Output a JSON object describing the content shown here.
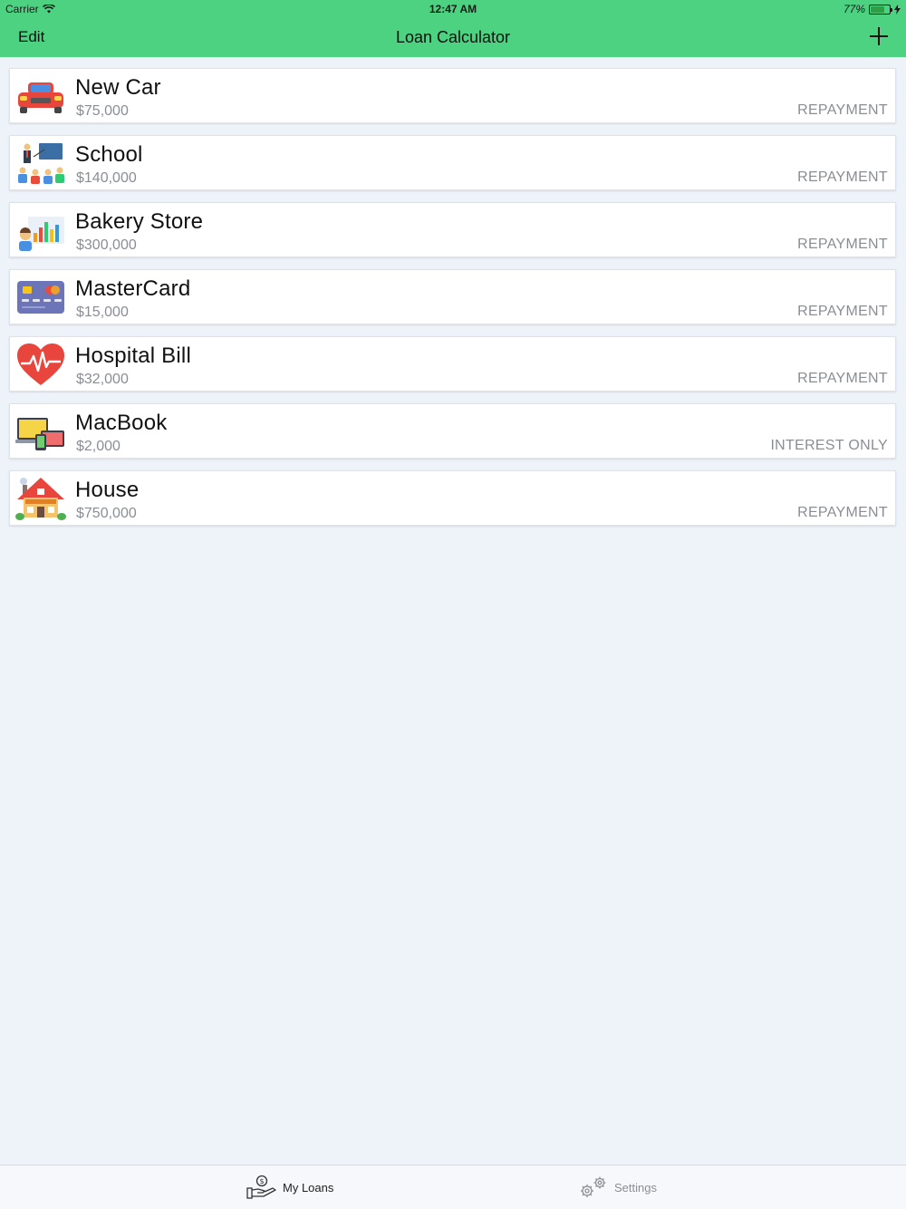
{
  "status_bar": {
    "carrier": "Carrier",
    "time": "12:47 AM",
    "battery": "77%",
    "battery_level": 0.77
  },
  "nav": {
    "edit_label": "Edit",
    "title": "Loan Calculator",
    "add_icon": "plus-icon"
  },
  "loans": [
    {
      "title": "New Car",
      "amount": "$75,000",
      "type": "REPAYMENT",
      "icon": "car-icon"
    },
    {
      "title": "School",
      "amount": "$140,000",
      "type": "REPAYMENT",
      "icon": "school-icon"
    },
    {
      "title": "Bakery Store",
      "amount": "$300,000",
      "type": "REPAYMENT",
      "icon": "bakery-store-icon"
    },
    {
      "title": "MasterCard",
      "amount": "$15,000",
      "type": "REPAYMENT",
      "icon": "credit-card-icon"
    },
    {
      "title": "Hospital Bill",
      "amount": "$32,000",
      "type": "REPAYMENT",
      "icon": "heart-icon"
    },
    {
      "title": "MacBook",
      "amount": "$2,000",
      "type": "INTEREST ONLY",
      "icon": "laptop-icon"
    },
    {
      "title": "House",
      "amount": "$750,000",
      "type": "REPAYMENT",
      "icon": "house-icon"
    }
  ],
  "tabs": [
    {
      "label": "My Loans",
      "icon": "loans-hand-icon",
      "active": true
    },
    {
      "label": "Settings",
      "icon": "gear-icon",
      "active": false
    }
  ],
  "colors": {
    "accent": "#4cd280",
    "background": "#eef2f9",
    "secondary_text": "#8a8e94"
  }
}
